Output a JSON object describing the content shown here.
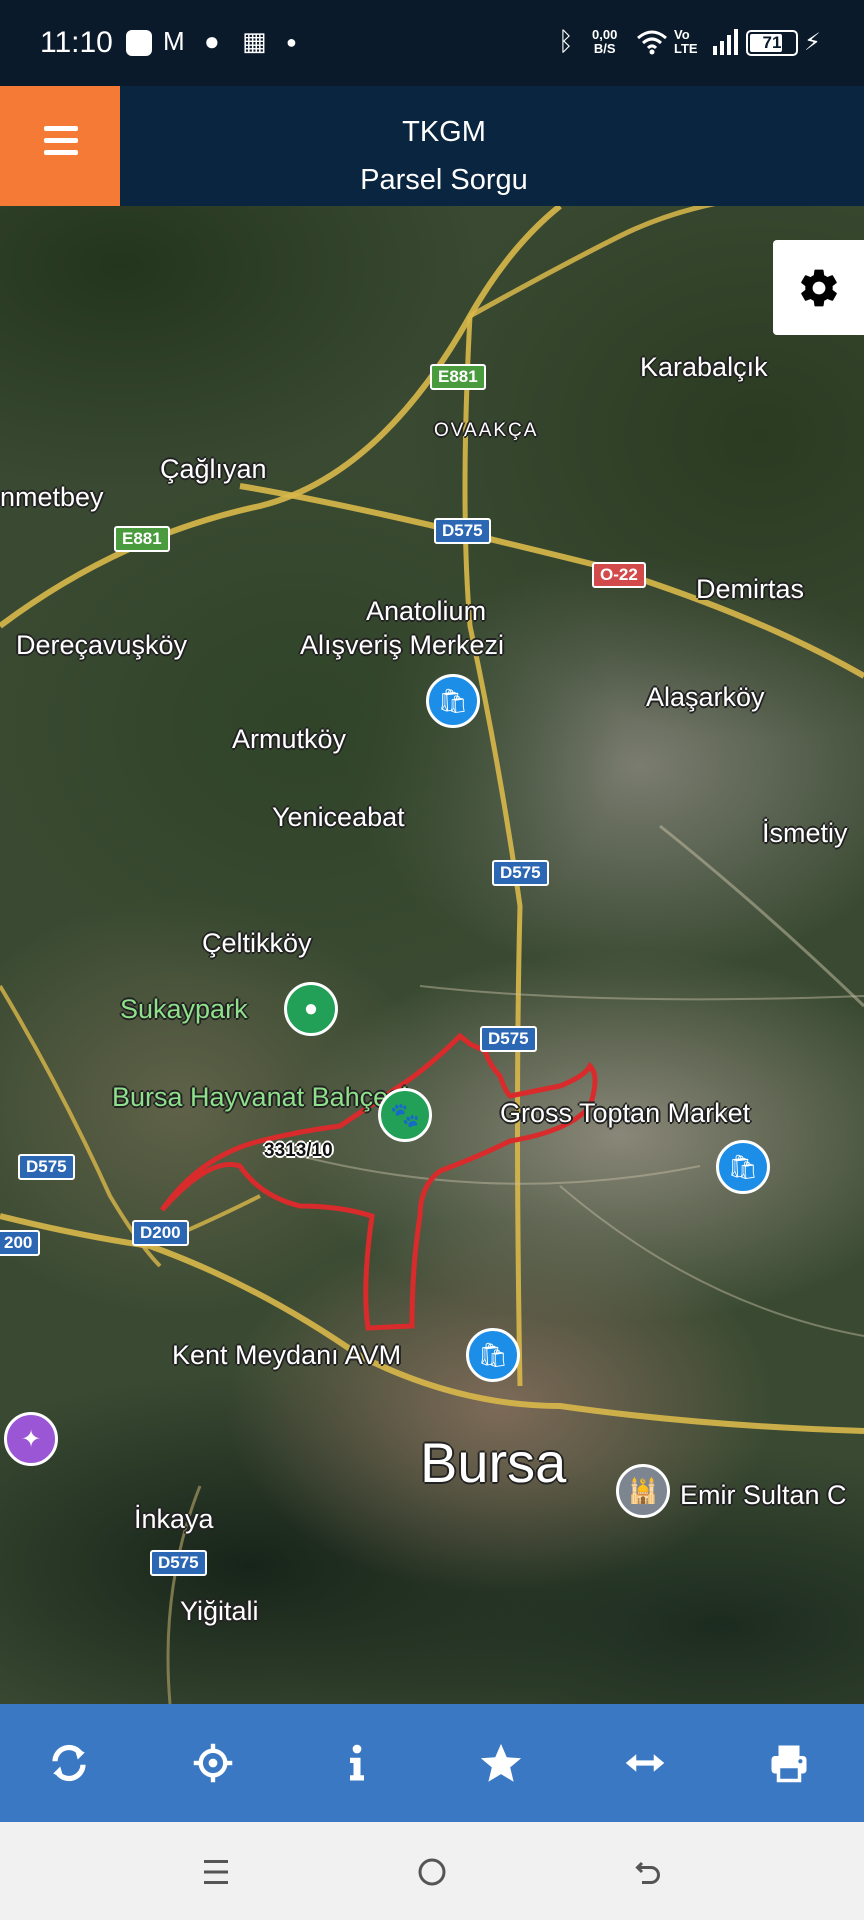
{
  "status_bar": {
    "time": "11:10",
    "net_speed_value": "0,00",
    "net_speed_unit": "B/S",
    "volte_top": "Vo",
    "volte_bottom": "LTE",
    "battery_level": "71"
  },
  "header": {
    "title": "TKGM",
    "subtitle": "Parsel Sorgu"
  },
  "map": {
    "labels": {
      "karabalcik": "Karabalçık",
      "ovaakca": "OVAAKÇA",
      "caglayan": "Çağlıyan",
      "ahmetbey": "nmetbey",
      "anatolium_1": "Anatolium",
      "anatolium_2": "Alışveriş Merkezi",
      "demirtas": "Demirtas",
      "derecavuskoy": "Dereçavuşköy",
      "alasarkoy": "Alaşarköy",
      "armutkoy": "Armutköy",
      "yeniceabat": "Yeniceabat",
      "ismetiye": "İsmetiy",
      "celtikkoy": "Çeltikköy",
      "sukaypark": "Sukaypark",
      "hayvanat": "Bursa Hayvanat Bahçesi",
      "gross": "Gross Toptan Market",
      "parcel": "3313/10",
      "kent_meydani": "Kent Meydanı AVM",
      "bursa": "Bursa",
      "emir_sultan": "Emir Sultan C",
      "inkaya": "İnkaya",
      "yigitali": "Yiğitali"
    },
    "shields": {
      "e881_top": "E881",
      "e881_left": "E881",
      "d575_top": "D575",
      "o22": "O-22",
      "d575_mid": "D575",
      "d575_lower": "D575",
      "d575_left": "D575",
      "d200": "D200",
      "d200_left": "200",
      "d575_bottom": "D575"
    },
    "colors": {
      "parcel_outline": "#d92b2b",
      "road": "#d9b84a"
    },
    "icons": {
      "settings": "gear-icon",
      "shopping": "shopping-bag-icon",
      "park": "park-icon",
      "zoo": "paw-icon",
      "mosque": "mosque-icon"
    }
  },
  "toolbar": {
    "icons": [
      "refresh-icon",
      "crosshair-icon",
      "info-icon",
      "star-icon",
      "measure-icon",
      "print-icon"
    ],
    "color": "#3a78c3"
  },
  "accent_color": "#f47a35"
}
